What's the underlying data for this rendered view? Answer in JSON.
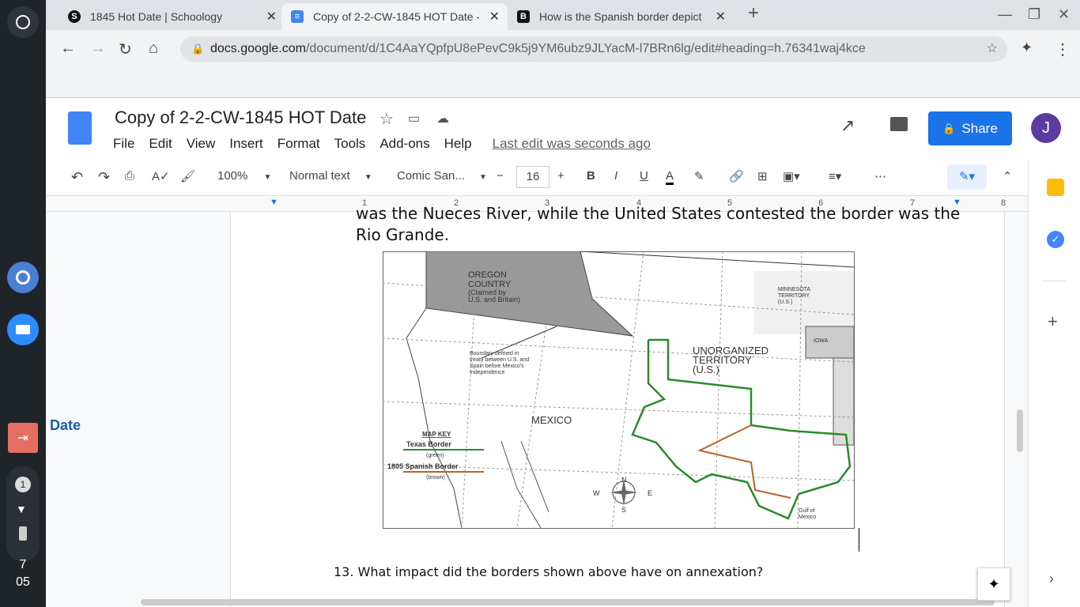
{
  "os": {
    "notification_count": "1",
    "time_hour": "7",
    "time_min": "05"
  },
  "browser": {
    "tabs": [
      {
        "title": "1845 Hot Date | Schoology",
        "icon": "schoology-icon"
      },
      {
        "title": "Copy of 2-2-CW-1845 HOT Date -",
        "icon": "docs-icon"
      },
      {
        "title": "How is the Spanish border depict",
        "icon": "brainly-icon"
      }
    ],
    "url_host": "docs.google.com",
    "url_path": "/document/d/1C4AaYQpfpU8ePevC9k5j9YM6ubz9JLYacM-l7BRn6lg/edit#heading=h.76341waj4kce"
  },
  "doc": {
    "title": "Copy of 2-2-CW-1845 HOT Date",
    "menu": [
      "File",
      "Edit",
      "View",
      "Insert",
      "Format",
      "Tools",
      "Add-ons",
      "Help"
    ],
    "last_edit": "Last edit was seconds ago",
    "share": "Share",
    "avatar": "J",
    "zoom": "100%",
    "style": "Normal text",
    "font": "Comic San...",
    "font_size": "16",
    "ruler": [
      "1",
      "2",
      "3",
      "4",
      "5",
      "6",
      "7",
      "8"
    ],
    "outline_item": "Date",
    "text_line1": "was the Nueces River, while the United States contested the border was the",
    "text_line2": "Rio Grande.",
    "question": "13. What impact did the borders shown above have on annexation?"
  },
  "map": {
    "oregon": [
      "OREGON",
      "COUNTRY",
      "(Claimed by",
      "U.S. and Britain)"
    ],
    "unorganized": [
      "UNORGANIZED",
      "TERRITORY",
      "(U.S.)"
    ],
    "minnesota": [
      "MINNESOTA",
      "TERRITORY",
      "(U.S.)"
    ],
    "iowa": "IOWA",
    "mexico": "MEXICO",
    "boundary_note": [
      "Boundary defined in",
      "treaty between U.S. and",
      "Spain before Mexico's",
      "Independence"
    ],
    "key_title": "MAP KEY",
    "key_texas": "Texas Border",
    "key_texas_color_label": "(green)",
    "key_spanish": "1805 Spanish Border",
    "key_spanish_color_label": "(brown)",
    "gulf": [
      "Gulf of",
      "Mexico"
    ],
    "compass": [
      "N",
      "S",
      "W",
      "E"
    ],
    "colors": {
      "texas": "#2a8a2a",
      "spanish": "#b5652a"
    }
  }
}
